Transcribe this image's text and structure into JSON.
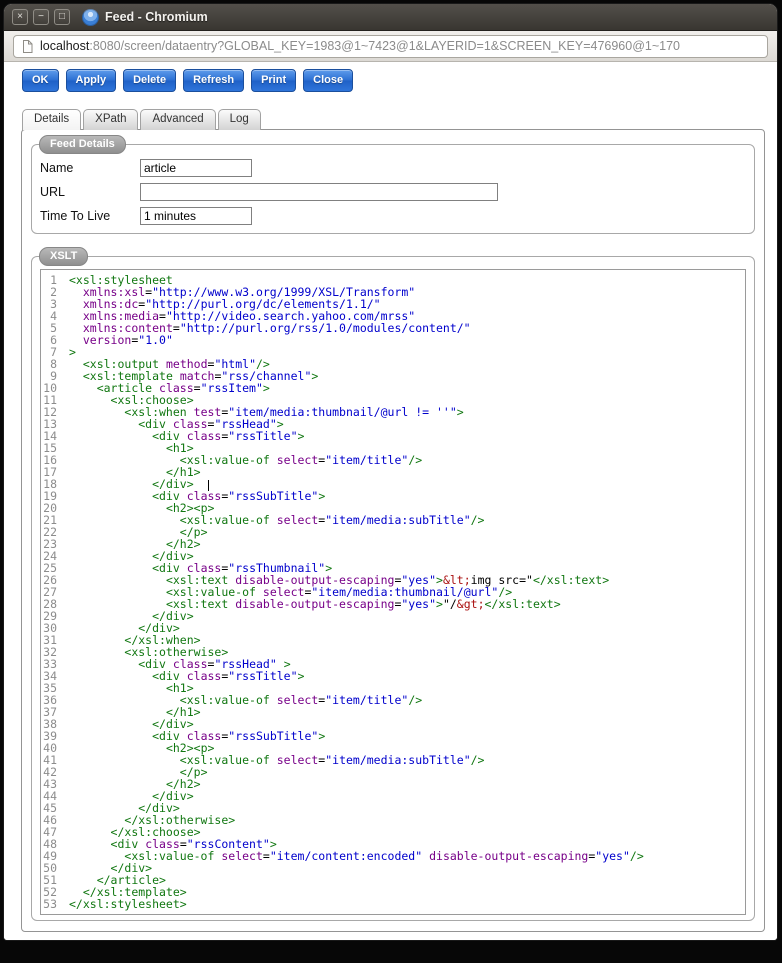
{
  "window": {
    "title": "Feed - Chromium",
    "controls": [
      {
        "name": "close",
        "glyph": "×"
      },
      {
        "name": "minimize",
        "glyph": "−"
      },
      {
        "name": "maximize",
        "glyph": "□"
      }
    ]
  },
  "browser": {
    "url_host": "localhost",
    "url_rest": ":8080/screen/dataentry?GLOBAL_KEY=1983@1~7423@1&LAYERID=1&SCREEN_KEY=476960@1~170"
  },
  "toolbar": {
    "buttons": [
      "OK",
      "Apply",
      "Delete",
      "Refresh",
      "Print",
      "Close"
    ]
  },
  "tabs": [
    {
      "label": "Details",
      "active": true
    },
    {
      "label": "XPath",
      "active": false
    },
    {
      "label": "Advanced",
      "active": false
    },
    {
      "label": "Log",
      "active": false
    }
  ],
  "feed_details": {
    "legend": "Feed Details",
    "fields": [
      {
        "label": "Name",
        "value": "article"
      },
      {
        "label": "URL",
        "value": ""
      },
      {
        "label": "Time To Live",
        "value": "1 minutes"
      }
    ]
  },
  "xslt": {
    "legend": "XSLT",
    "cursor": {
      "line": 18,
      "col": 20
    },
    "code_lines": [
      "<xsl:stylesheet",
      "  xmlns:xsl=\"http://www.w3.org/1999/XSL/Transform\"",
      "  xmlns:dc=\"http://purl.org/dc/elements/1.1/\"",
      "  xmlns:media=\"http://video.search.yahoo.com/mrss\"",
      "  xmlns:content=\"http://purl.org/rss/1.0/modules/content/\"",
      "  version=\"1.0\"",
      ">",
      "  <xsl:output method=\"html\"/>",
      "  <xsl:template match=\"rss/channel\">",
      "    <article class=\"rssItem\">",
      "      <xsl:choose>",
      "        <xsl:when test=\"item/media:thumbnail/@url != ''\">",
      "          <div class=\"rssHead\">",
      "            <div class=\"rssTitle\">",
      "              <h1>",
      "                <xsl:value-of select=\"item/title\"/>",
      "              </h1>",
      "            </div>",
      "            <div class=\"rssSubTitle\">",
      "              <h2><p>",
      "                <xsl:value-of select=\"item/media:subTitle\"/>",
      "                </p>",
      "              </h2>",
      "            </div>",
      "            <div class=\"rssThumbnail\">",
      "              <xsl:text disable-output-escaping=\"yes\">&lt;img src=\"</xsl:text>",
      "              <xsl:value-of select=\"item/media:thumbnail/@url\"/>",
      "              <xsl:text disable-output-escaping=\"yes\">\"/&gt;</xsl:text>",
      "            </div>",
      "          </div>",
      "        </xsl:when>",
      "        <xsl:otherwise>",
      "          <div class=\"rssHead\" >",
      "            <div class=\"rssTitle\">",
      "              <h1>",
      "                <xsl:value-of select=\"item/title\"/>",
      "              </h1>",
      "            </div>",
      "            <div class=\"rssSubTitle\">",
      "              <h2><p>",
      "                <xsl:value-of select=\"item/media:subTitle\"/>",
      "                </p>",
      "              </h2>",
      "            </div>",
      "          </div>",
      "        </xsl:otherwise>",
      "      </xsl:choose>",
      "      <div class=\"rssContent\">",
      "        <xsl:value-of select=\"item/content:encoded\" disable-output-escaping=\"yes\"/>",
      "      </div>",
      "    </article>",
      "  </xsl:template>",
      "</xsl:stylesheet>"
    ]
  },
  "colors": {
    "accent_button": "#2c70d3",
    "tok_tag": "#117711",
    "tok_attr": "#770088",
    "tok_str": "#0000cc",
    "tok_ent": "#aa1111",
    "line_number": "#8c8c8c"
  }
}
